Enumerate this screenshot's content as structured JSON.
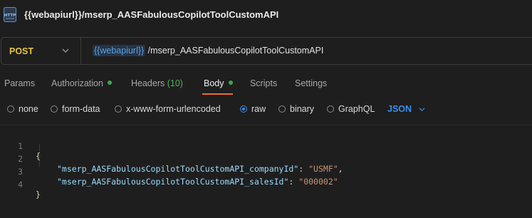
{
  "title": "{{webapiurl}}/mserp_AASFabulousCopilotToolCustomAPI",
  "request": {
    "method": "POST",
    "url_variable": "{{webapiurl}}",
    "url_path": " /mserp_AASFabulousCopilotToolCustomAPI"
  },
  "tabs": {
    "params": "Params",
    "authorization": "Authorization",
    "headers": "Headers",
    "headers_count": "(10)",
    "body": "Body",
    "scripts": "Scripts",
    "settings": "Settings",
    "active": "Body"
  },
  "body_modes": {
    "none": "none",
    "form_data": "form-data",
    "urlencoded": "x-www-form-urlencoded",
    "raw": "raw",
    "binary": "binary",
    "graphql": "GraphQL",
    "selected": "raw",
    "language": "JSON"
  },
  "editor": {
    "line_numbers": [
      "1",
      "2",
      "3",
      "4"
    ],
    "open_brace": "{",
    "close_brace": "}",
    "entry1_key": "\"mserp_AASFabulousCopilotToolCustomAPI_companyId\"",
    "entry1_sep": ": ",
    "entry1_value": "\"USMF\"",
    "entry1_comma": ",",
    "entry2_key": "\"mserp_AASFabulousCopilotToolCustomAPI_salesId\"",
    "entry2_sep": ": ",
    "entry2_value": "\"000002\""
  },
  "colors": {
    "method": "#e6c547",
    "accent": "#ef6c2f",
    "link": "#3b8eea",
    "status_dot": "#3ea44f"
  },
  "icons": {
    "request_type": "http-icon",
    "method_dropdown": "chevron-down-icon",
    "language_dropdown": "chevron-down-icon"
  }
}
